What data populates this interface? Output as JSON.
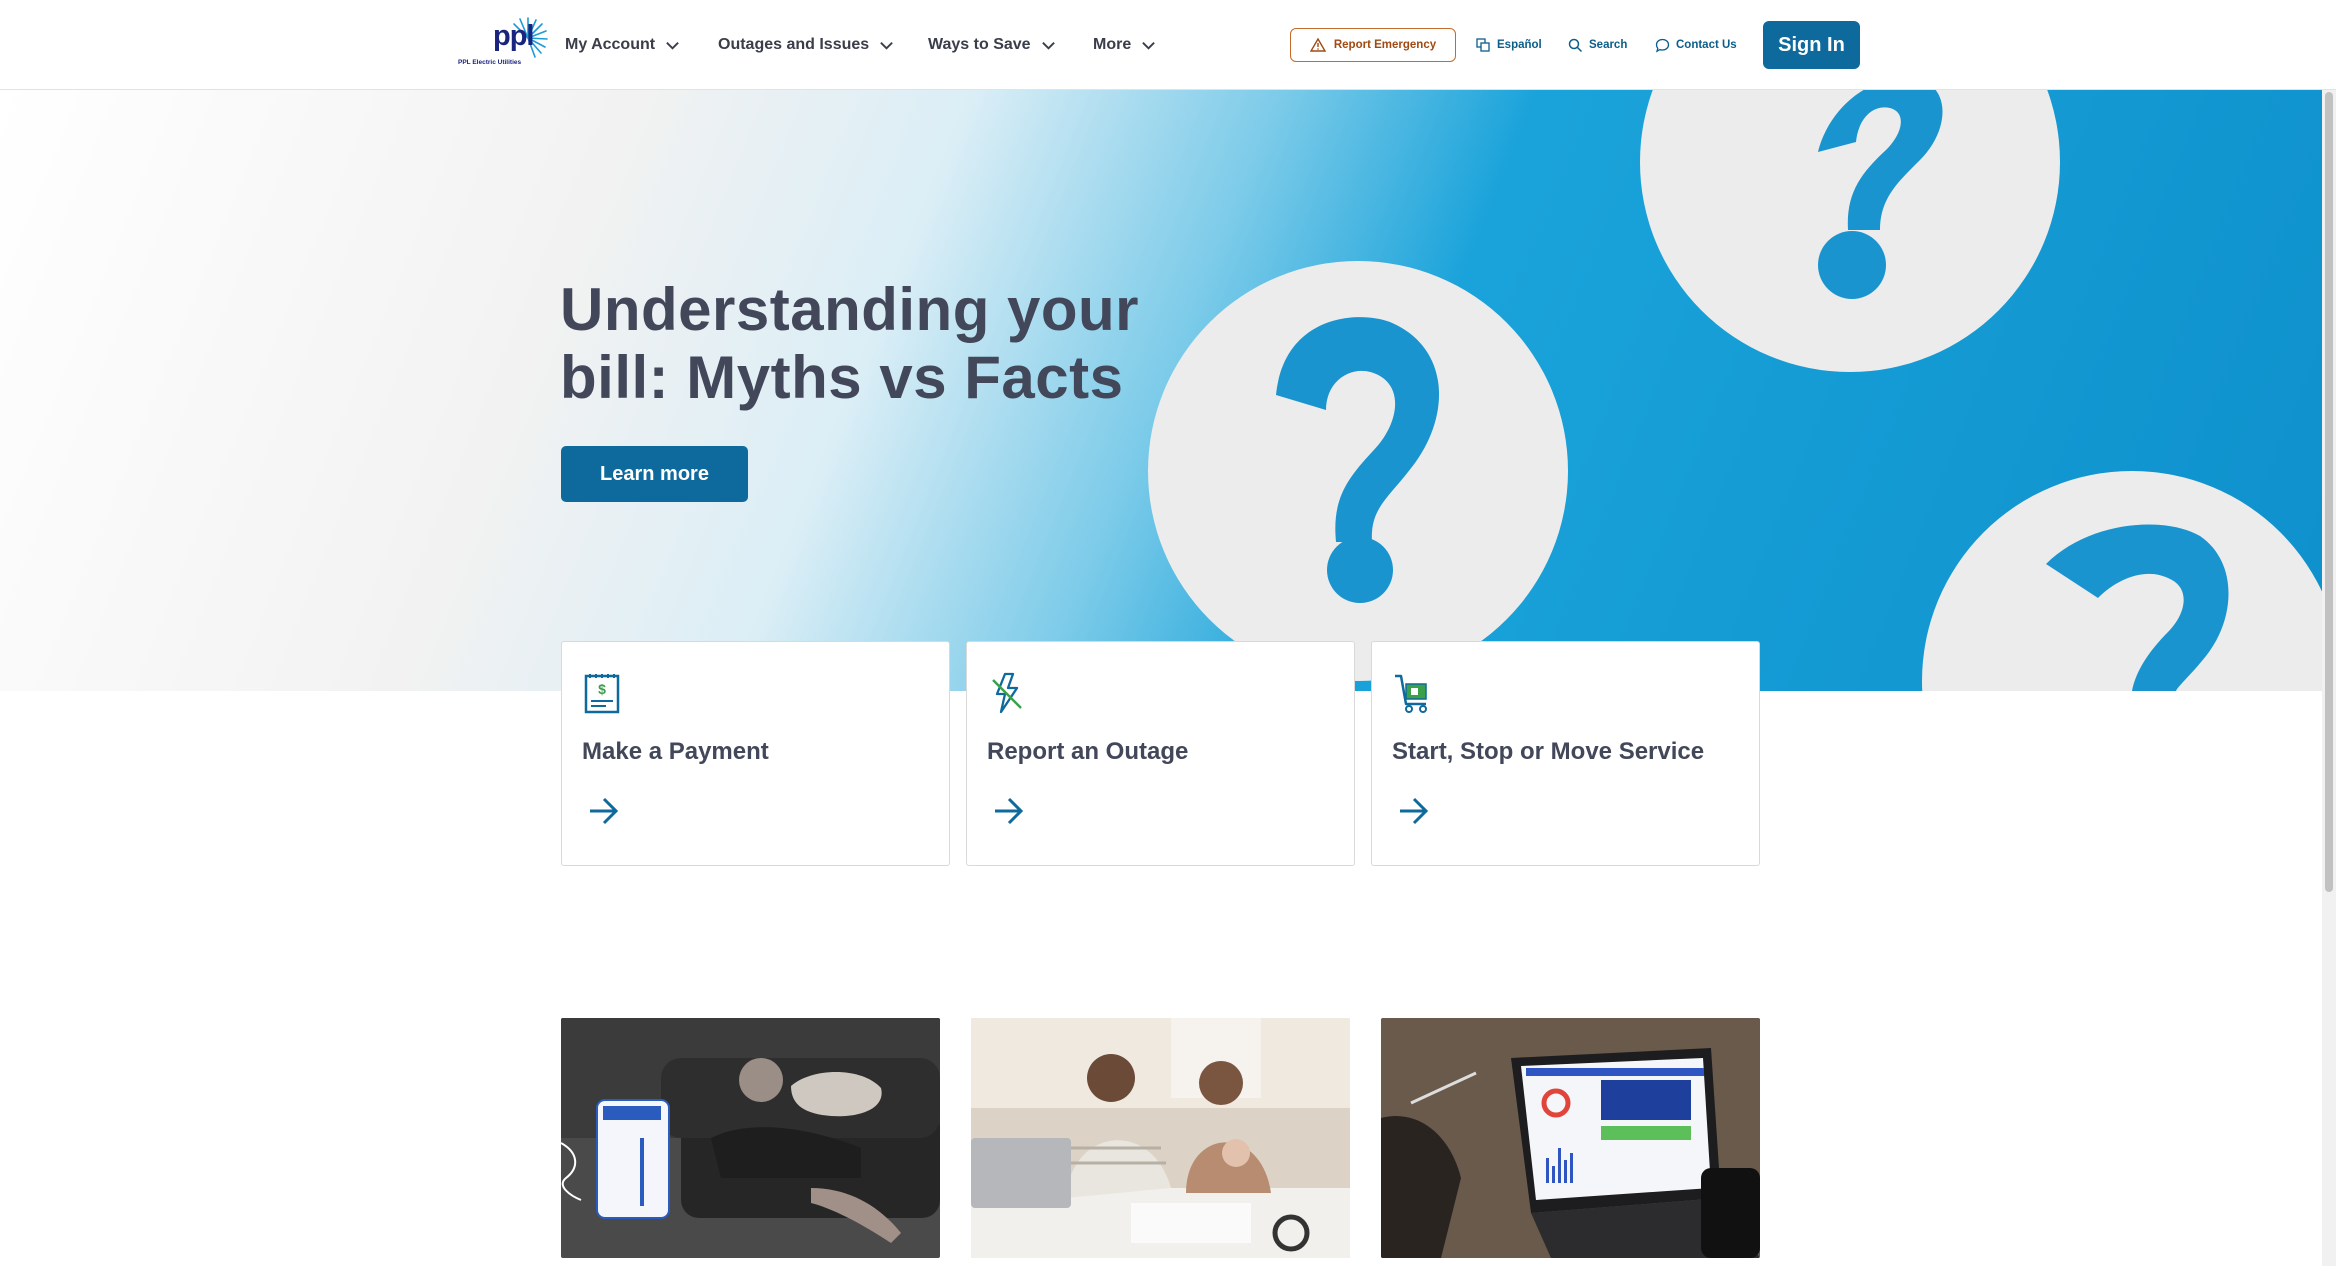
{
  "header": {
    "logo_text": "ppl",
    "logo_subtext": "PPL Electric Utilities",
    "nav": [
      {
        "label": "My Account"
      },
      {
        "label": "Outages and Issues"
      },
      {
        "label": "Ways to Save"
      },
      {
        "label": "More"
      }
    ],
    "report_emergency": "Report Emergency",
    "espanol": "Español",
    "search": "Search",
    "contact": "Contact Us",
    "sign_in": "Sign In"
  },
  "hero": {
    "title": "Understanding your bill: Myths vs Facts",
    "cta": "Learn more"
  },
  "cards": [
    {
      "title": "Make a Payment",
      "icon": "bill-payment-icon"
    },
    {
      "title": "Report an Outage",
      "icon": "power-outage-icon"
    },
    {
      "title": "Start, Stop or Move Service",
      "icon": "moving-cart-icon"
    }
  ],
  "colors": {
    "primary": "#0e6a9c",
    "heading": "#42475a",
    "emergency": "#c56b2a",
    "hero_blue": "#0e90cc",
    "icon_green": "#3aa04a"
  }
}
